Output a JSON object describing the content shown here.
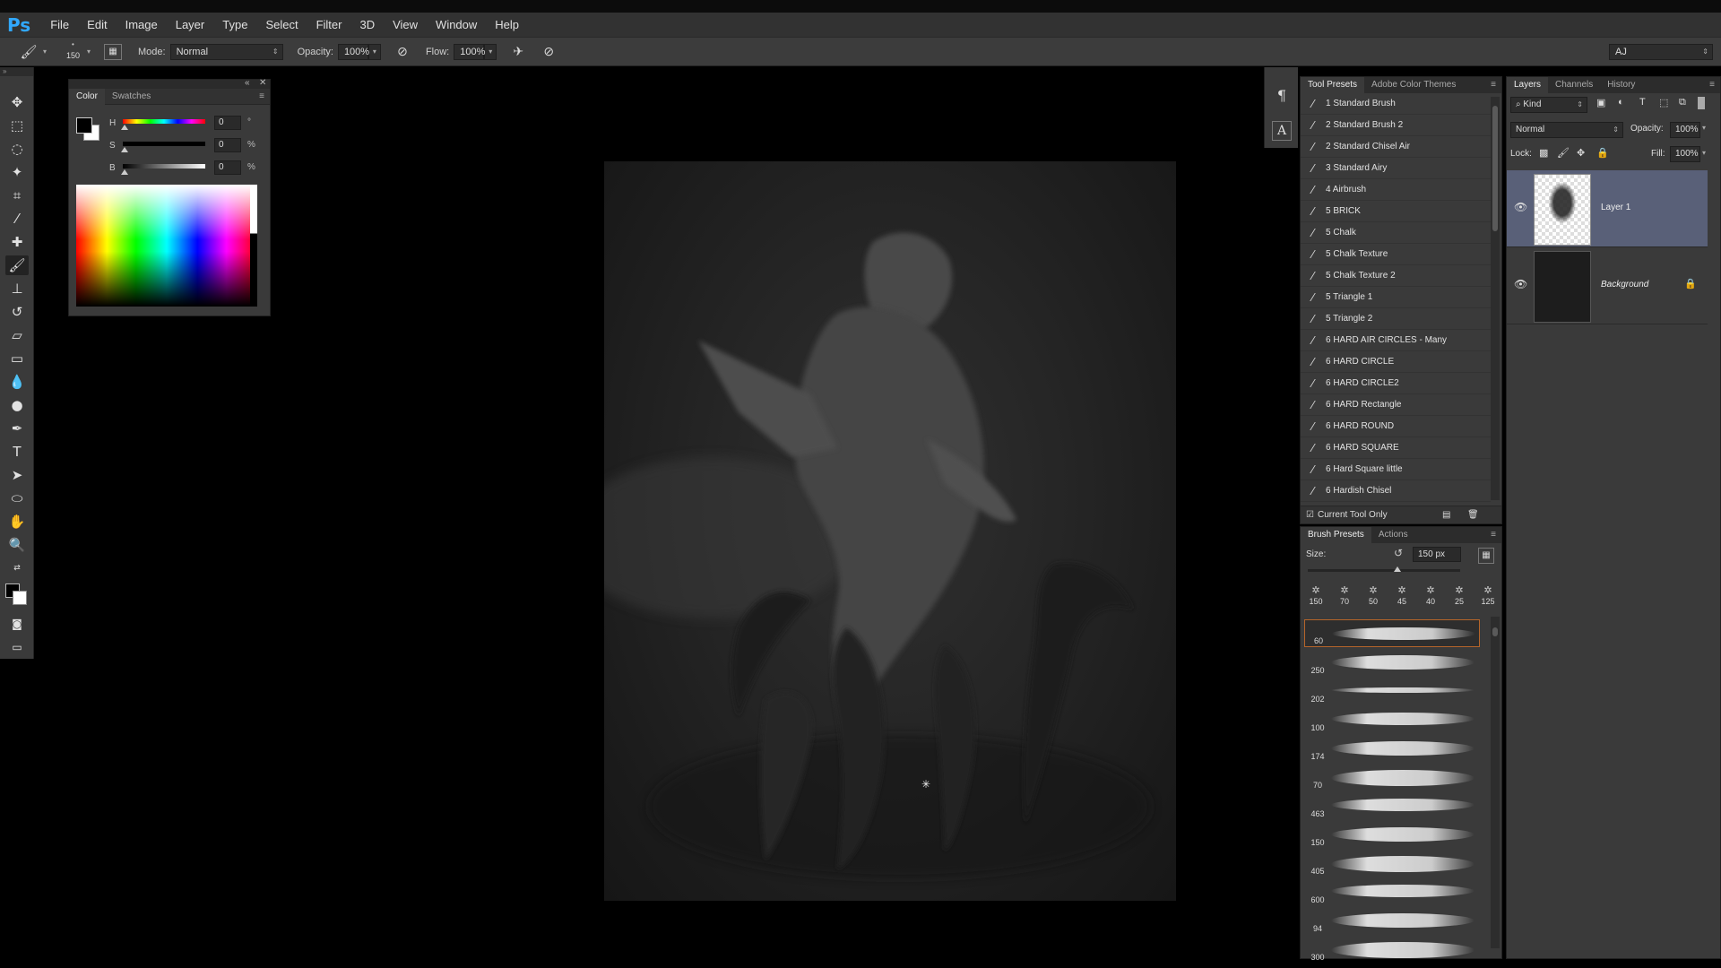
{
  "app": {
    "logo": "Ps"
  },
  "menu": [
    "File",
    "Edit",
    "Image",
    "Layer",
    "Type",
    "Select",
    "Filter",
    "3D",
    "View",
    "Window",
    "Help"
  ],
  "options_bar": {
    "brush_size": "150",
    "mode_label": "Mode:",
    "mode_value": "Normal",
    "opacity_label": "Opacity:",
    "opacity_value": "100%",
    "flow_label": "Flow:",
    "flow_value": "100%",
    "workspace_value": "AJ"
  },
  "color_panel": {
    "tabs": [
      "Color",
      "Swatches"
    ],
    "h_label": "H",
    "h_value": "0",
    "h_unit": "°",
    "s_label": "S",
    "s_value": "0",
    "s_unit": "%",
    "b_label": "B",
    "b_value": "0",
    "b_unit": "%"
  },
  "tool_presets": {
    "tabs": [
      "Tool Presets",
      "Adobe Color Themes"
    ],
    "items": [
      "1 Standard Brush",
      "2 Standard Brush 2",
      "2 Standard Chisel Air",
      "3 Standard Airy",
      "4 Airbrush",
      "5 BRICK",
      "5 Chalk",
      "5 Chalk Texture",
      "5 Chalk Texture 2",
      "5 Triangle 1",
      "5 Triangle 2",
      "6 HARD AIR CIRCLES - Many",
      "6 HARD CIRCLE",
      "6 HARD CIRCLE2",
      "6 HARD Rectangle",
      "6 HARD ROUND",
      "6 HARD SQUARE",
      "6 Hard Square little",
      "6 Hardish Chisel"
    ],
    "footer": "Current Tool Only"
  },
  "brush_presets": {
    "tabs": [
      "Brush Presets",
      "Actions"
    ],
    "size_label": "Size:",
    "size_value": "150 px",
    "tips": [
      "150",
      "70",
      "50",
      "45",
      "40",
      "25",
      "125"
    ],
    "strokes": [
      "60",
      "250",
      "202",
      "100",
      "174",
      "70",
      "463",
      "150",
      "405",
      "600",
      "94",
      "300"
    ]
  },
  "layers_panel": {
    "tabs": [
      "Layers",
      "Channels",
      "History"
    ],
    "kind_label": "Kind",
    "blend_mode": "Normal",
    "opacity_label": "Opacity:",
    "opacity_value": "100%",
    "lock_label": "Lock:",
    "fill_label": "Fill:",
    "fill_value": "100%",
    "layers": [
      {
        "name": "Layer 1",
        "selected": true
      },
      {
        "name": "Background",
        "selected": false,
        "locked": true
      }
    ]
  },
  "colors": {
    "chrome_dark": "#323232",
    "panel": "#3a3a3a",
    "layer_selected": "#596078",
    "ps_blue": "#31a8ff",
    "brush_highlight": "#b5652a"
  }
}
